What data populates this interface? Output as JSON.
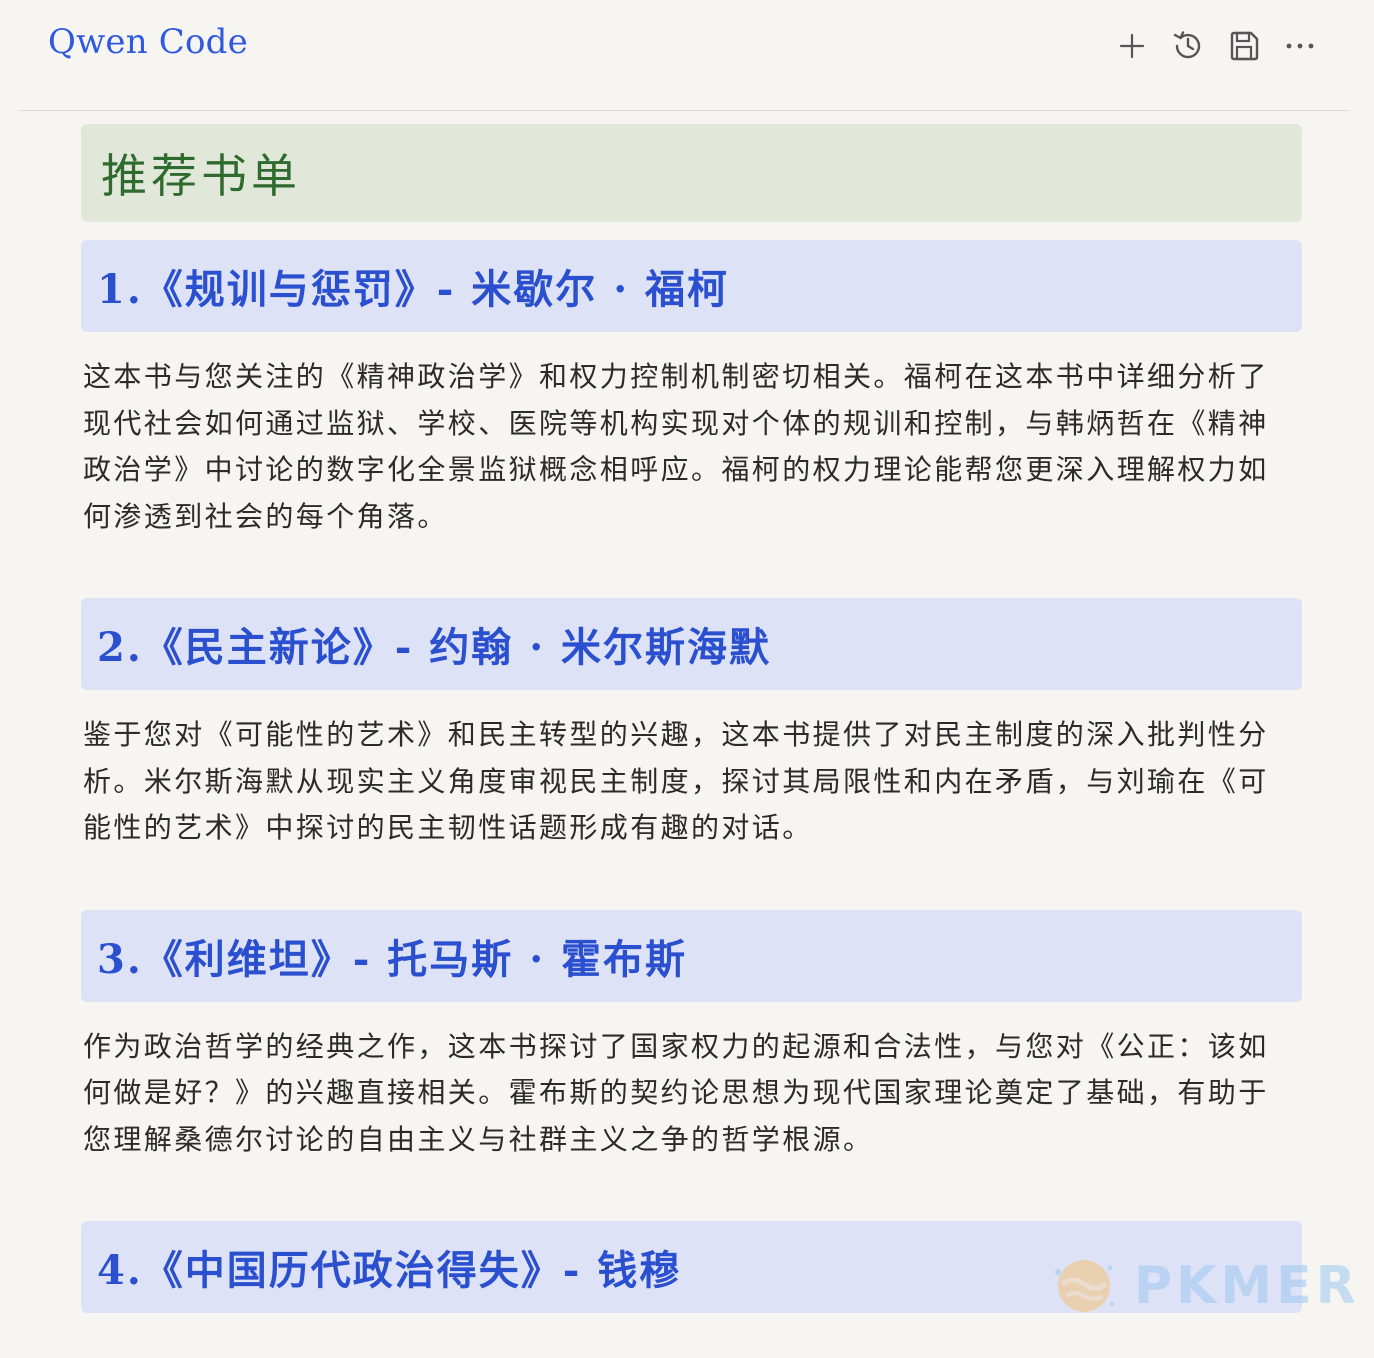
{
  "header": {
    "title": "Qwen Code",
    "actions": [
      {
        "name": "new",
        "icon": "plus-icon"
      },
      {
        "name": "history",
        "icon": "history-icon"
      },
      {
        "name": "save",
        "icon": "save-icon"
      },
      {
        "name": "more",
        "icon": "more-icon"
      }
    ],
    "accent_color": "#2f59e0"
  },
  "section": {
    "title": "推荐书单",
    "bg_color": "#e1e8da",
    "text_color": "#2f6a2f"
  },
  "books": [
    {
      "heading": "1.《规训与惩罚》- 米歇尔 · 福柯",
      "description": "这本书与您关注的《精神政治学》和权力控制机制密切相关。福柯在这本书中详细分析了现代社会如何通过监狱、学校、医院等机构实现对个体的规训和控制，与韩炳哲在《精神政治学》中讨论的数字化全景监狱概念相呼应。福柯的权力理论能帮您更深入理解权力如何渗透到社会的每个角落。"
    },
    {
      "heading": "2.《民主新论》- 约翰 · 米尔斯海默",
      "description": "鉴于您对《可能性的艺术》和民主转型的兴趣，这本书提供了对民主制度的深入批判性分析。米尔斯海默从现实主义角度审视民主制度，探讨其局限性和内在矛盾，与刘瑜在《可能性的艺术》中探讨的民主韧性话题形成有趣的对话。"
    },
    {
      "heading": "3.《利维坦》- 托马斯 · 霍布斯",
      "description": "作为政治哲学的经典之作，这本书探讨了国家权力的起源和合法性，与您对《公正：该如何做是好？》的兴趣直接相关。霍布斯的契约论思想为现代国家理论奠定了基础，有助于您理解桑德尔讨论的自由主义与社群主义之争的哲学根源。"
    },
    {
      "heading": "4.《中国历代政治得失》- 钱穆",
      "description": ""
    }
  ],
  "watermark": {
    "text": "PKMER",
    "icon": "pkmer-logo-icon"
  }
}
